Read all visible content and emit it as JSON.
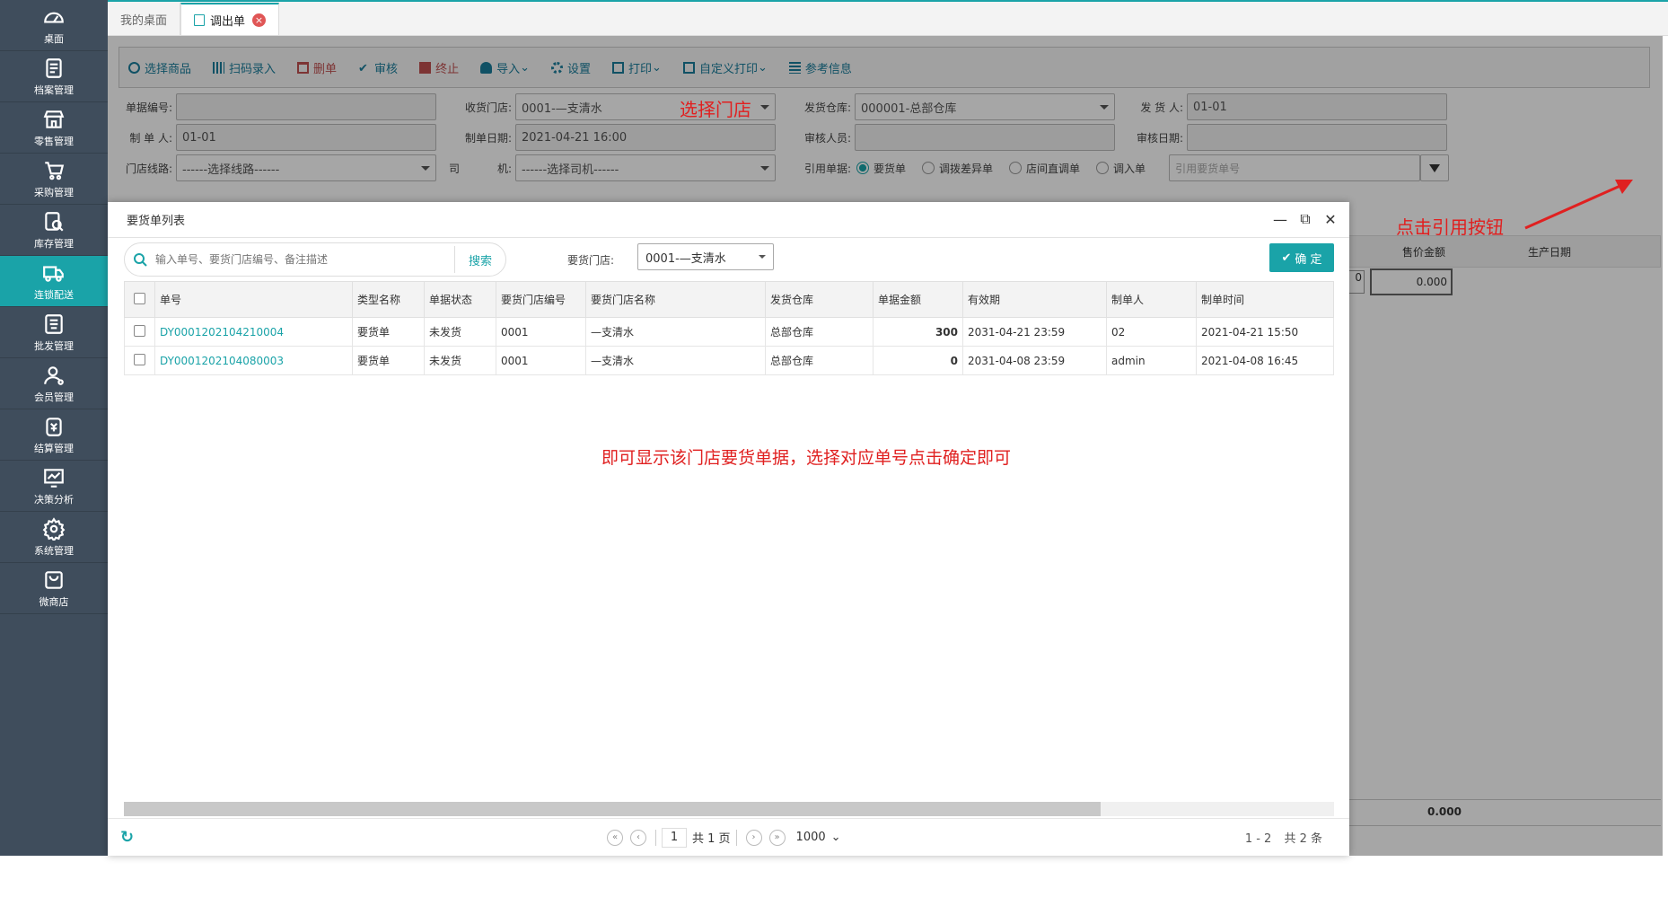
{
  "sidebar": {
    "items": [
      {
        "label": "桌面",
        "icon": "dashboard-icon"
      },
      {
        "label": "档案管理",
        "icon": "archive-icon"
      },
      {
        "label": "零售管理",
        "icon": "store-icon"
      },
      {
        "label": "采购管理",
        "icon": "cart-icon"
      },
      {
        "label": "库存管理",
        "icon": "inventory-icon"
      },
      {
        "label": "连锁配送",
        "icon": "truck-icon"
      },
      {
        "label": "批发管理",
        "icon": "wholesale-icon"
      },
      {
        "label": "会员管理",
        "icon": "member-icon"
      },
      {
        "label": "结算管理",
        "icon": "settlement-icon"
      },
      {
        "label": "决策分析",
        "icon": "chart-icon"
      },
      {
        "label": "系统管理",
        "icon": "gear-icon"
      },
      {
        "label": "微商店",
        "icon": "shop-bag-icon"
      }
    ]
  },
  "tabs": {
    "home": "我的桌面",
    "active": "调出单"
  },
  "toolbar": {
    "select_goods": "选择商品",
    "scan": "扫码录入",
    "delete": "删单",
    "audit": "审核",
    "stop": "终止",
    "import": "导入",
    "settings": "设置",
    "print": "打印",
    "custom_print": "自定义打印",
    "reference": "参考信息"
  },
  "form": {
    "doc_no_label": "单据编号:",
    "recv_store_label": "收货门店:",
    "recv_store_value": "0001-—支清水",
    "ship_wh_label": "发货仓库:",
    "ship_wh_value": "000001-总部仓库",
    "shipper_label": "发 货 人:",
    "shipper_value": "01-01",
    "maker_label": "制 单 人:",
    "maker_value": "01-01",
    "make_date_label": "制单日期:",
    "make_date_value": "2021-04-21 16:00",
    "auditor_label": "审核人员:",
    "audit_date_label": "审核日期:",
    "route_label": "门店线路:",
    "route_value": "------选择线路------",
    "driver_label_a": "司",
    "driver_label_b": "机:",
    "driver_value": "------选择司机------",
    "ref_label": "引用单据:",
    "ref_options": [
      "要货单",
      "调拨差异单",
      "店间直调单",
      "调入单"
    ],
    "ref_placeholder": "引用要货单号"
  },
  "background_grid": {
    "col_price": "售价金额",
    "col_date": "生产日期",
    "row_zero_a": "0",
    "row_value": "0.000",
    "footer_value": "0.000"
  },
  "annotations": {
    "select_store": "选择门店",
    "click_ref": "点击引用按钮",
    "hint": "即可显示该门店要货单据，选择对应单号点击确定即可"
  },
  "modal": {
    "title": "要货单列表",
    "search_placeholder": "输入单号、要货门店编号、备注描述",
    "search_btn": "搜索",
    "store_label": "要货门店:",
    "store_value": "0001-—支清水",
    "ok_label": "确 定",
    "columns": [
      "单号",
      "类型名称",
      "单据状态",
      "要货门店编号",
      "要货门店名称",
      "发货仓库",
      "单据金额",
      "有效期",
      "制单人",
      "制单时间"
    ],
    "rows": [
      {
        "no": "DY0001202104210004",
        "type": "要货单",
        "status": "未发货",
        "store_no": "0001",
        "store_name": "—支清水",
        "wh": "总部仓库",
        "amount": "300",
        "valid": "2031-04-21 23:59",
        "maker": "02",
        "time": "2021-04-21 15:50"
      },
      {
        "no": "DY0001202104080003",
        "type": "要货单",
        "status": "未发货",
        "store_no": "0001",
        "store_name": "—支清水",
        "wh": "总部仓库",
        "amount": "0",
        "valid": "2031-04-08 23:59",
        "maker": "admin",
        "time": "2021-04-08 16:45"
      }
    ],
    "pager": {
      "page": "1",
      "total_pages": "共 1 页",
      "page_size": "1000",
      "range": "1 - 2",
      "total": "共 2 条"
    }
  }
}
